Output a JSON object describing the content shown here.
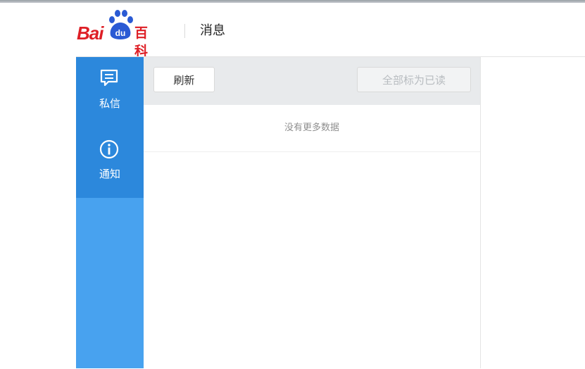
{
  "header": {
    "logo_text": "Bai",
    "logo_du": "du",
    "logo_suffix": "百科",
    "title": "消息"
  },
  "sidebar": {
    "items": [
      {
        "label": "私信",
        "icon": "chat-bubble-icon",
        "active": true
      },
      {
        "label": "通知",
        "icon": "info-circle-icon",
        "active": true
      }
    ]
  },
  "toolbar": {
    "refresh_label": "刷新",
    "mark_all_read_label": "全部标为已读",
    "mark_all_read_disabled": true
  },
  "message_list": {
    "empty_text": "没有更多数据"
  },
  "colors": {
    "brand_red": "#de1f26",
    "sidebar_blue": "#48a2ef",
    "sidebar_active_blue": "#2c88dc",
    "toolbar_gray": "#e8eaec"
  }
}
